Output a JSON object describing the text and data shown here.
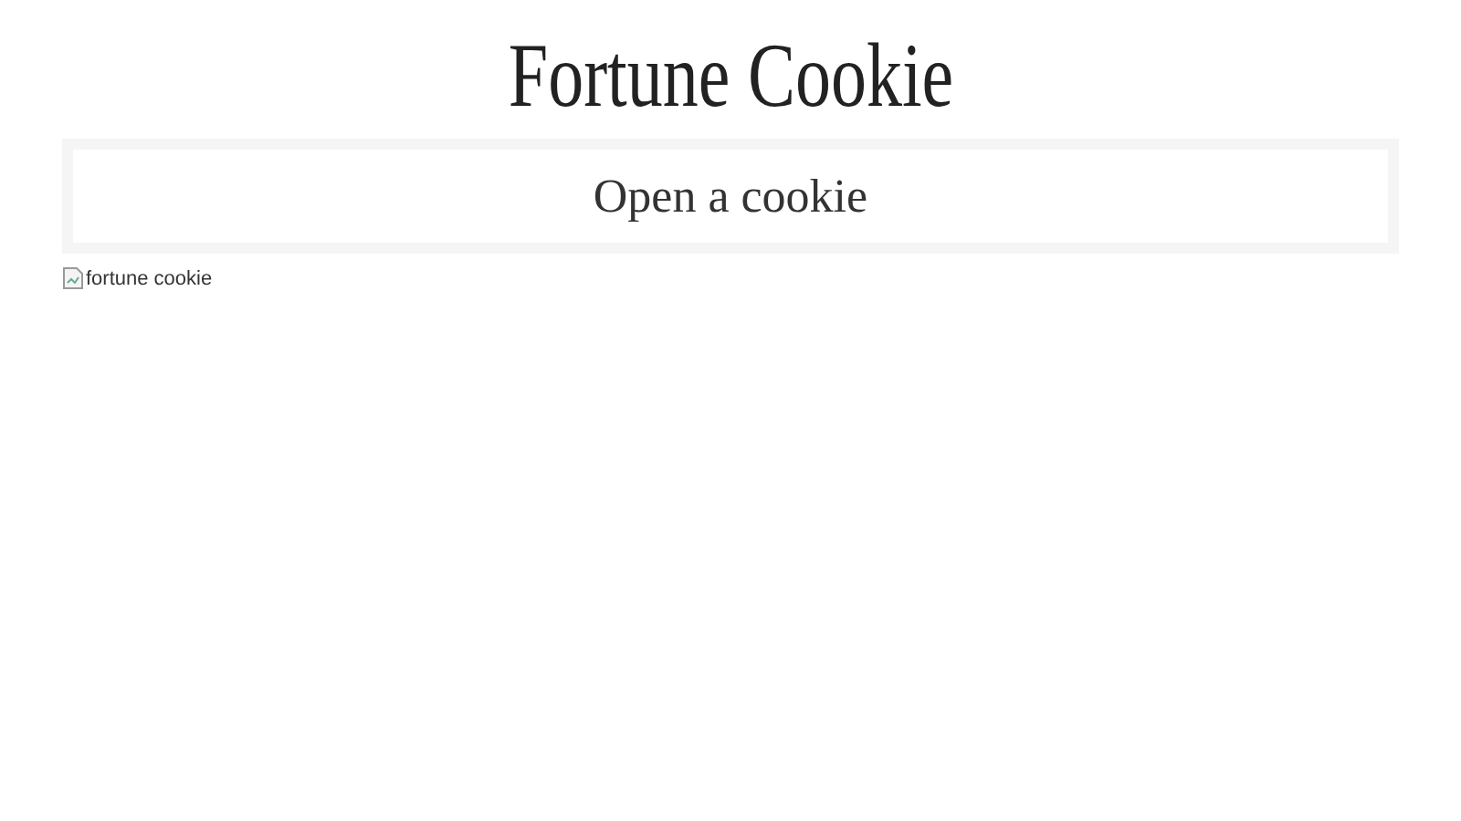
{
  "title": "Fortune Cookie",
  "button": {
    "label": "Open a cookie"
  },
  "image": {
    "alt": "fortune cookie"
  }
}
